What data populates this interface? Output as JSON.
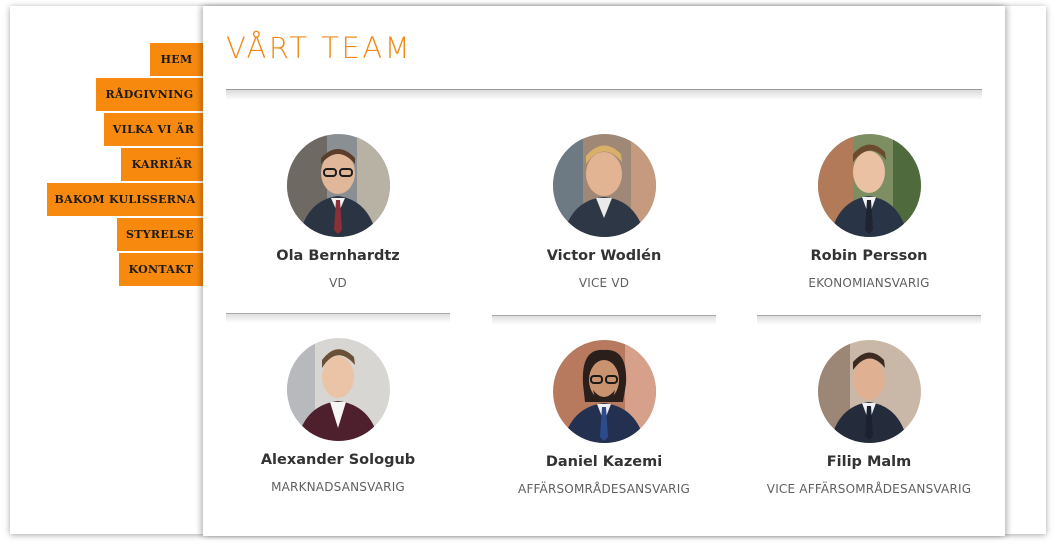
{
  "nav": {
    "items": [
      {
        "label": "HEM"
      },
      {
        "label": "RÅDGIVNING"
      },
      {
        "label": "VILKA VI ÄR"
      },
      {
        "label": "KARRIÄR"
      },
      {
        "label": "BAKOM KULISSERNA"
      },
      {
        "label": "STYRELSE"
      },
      {
        "label": "KONTAKT"
      }
    ]
  },
  "page": {
    "title": "VÅRT TEAM"
  },
  "team": [
    {
      "name": "Ola Bernhardtz",
      "role": "VD"
    },
    {
      "name": "Victor Wodlén",
      "role": "VICE VD"
    },
    {
      "name": "Robin Persson",
      "role": "EKONOMIANSVARIG"
    },
    {
      "name": "Alexander Sologub",
      "role": "MARKNADSANSVARIG"
    },
    {
      "name": "Daniel Kazemi",
      "role": "AFFÄRSOMRÅDESANSVARIG"
    },
    {
      "name": "Filip Malm",
      "role": "VICE AFFÄRSOMRÅDESANSVARIG"
    }
  ],
  "colors": {
    "accent": "#f7890f",
    "title": "#f18a19",
    "text": "#333333",
    "muted": "#5f5f5f"
  }
}
